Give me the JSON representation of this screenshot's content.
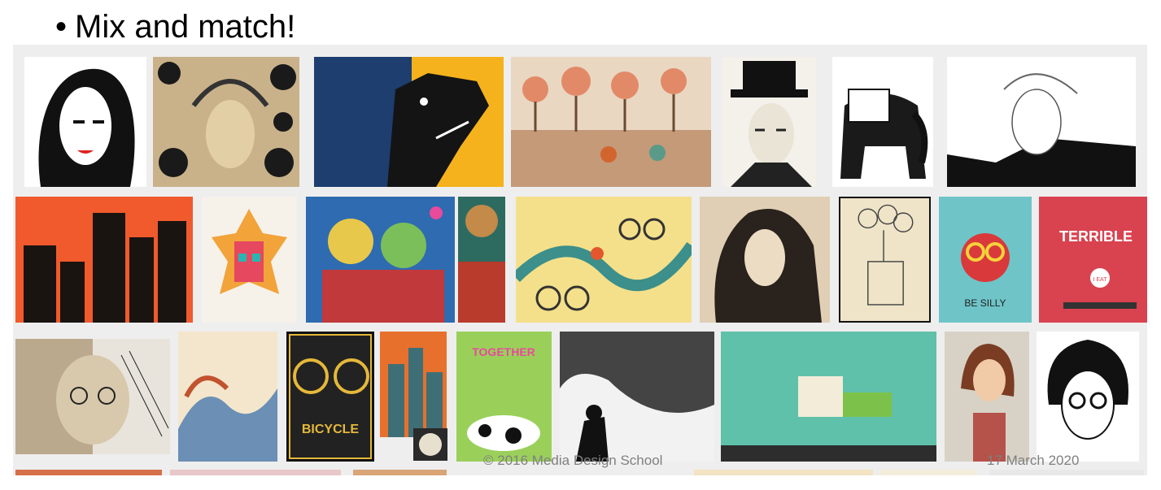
{
  "slide": {
    "title": "Mix and match!",
    "bullet": "•"
  },
  "footer": {
    "copyright": "© 2016 Media Design School",
    "date": "17 March 2020"
  },
  "collage": {
    "poster_text": {
      "terrible": "TERRIBLE",
      "be_silly": "BE SILLY",
      "bicycle": "BICYCLE",
      "together": "TOGETHER",
      "eat": "I EAT"
    }
  }
}
